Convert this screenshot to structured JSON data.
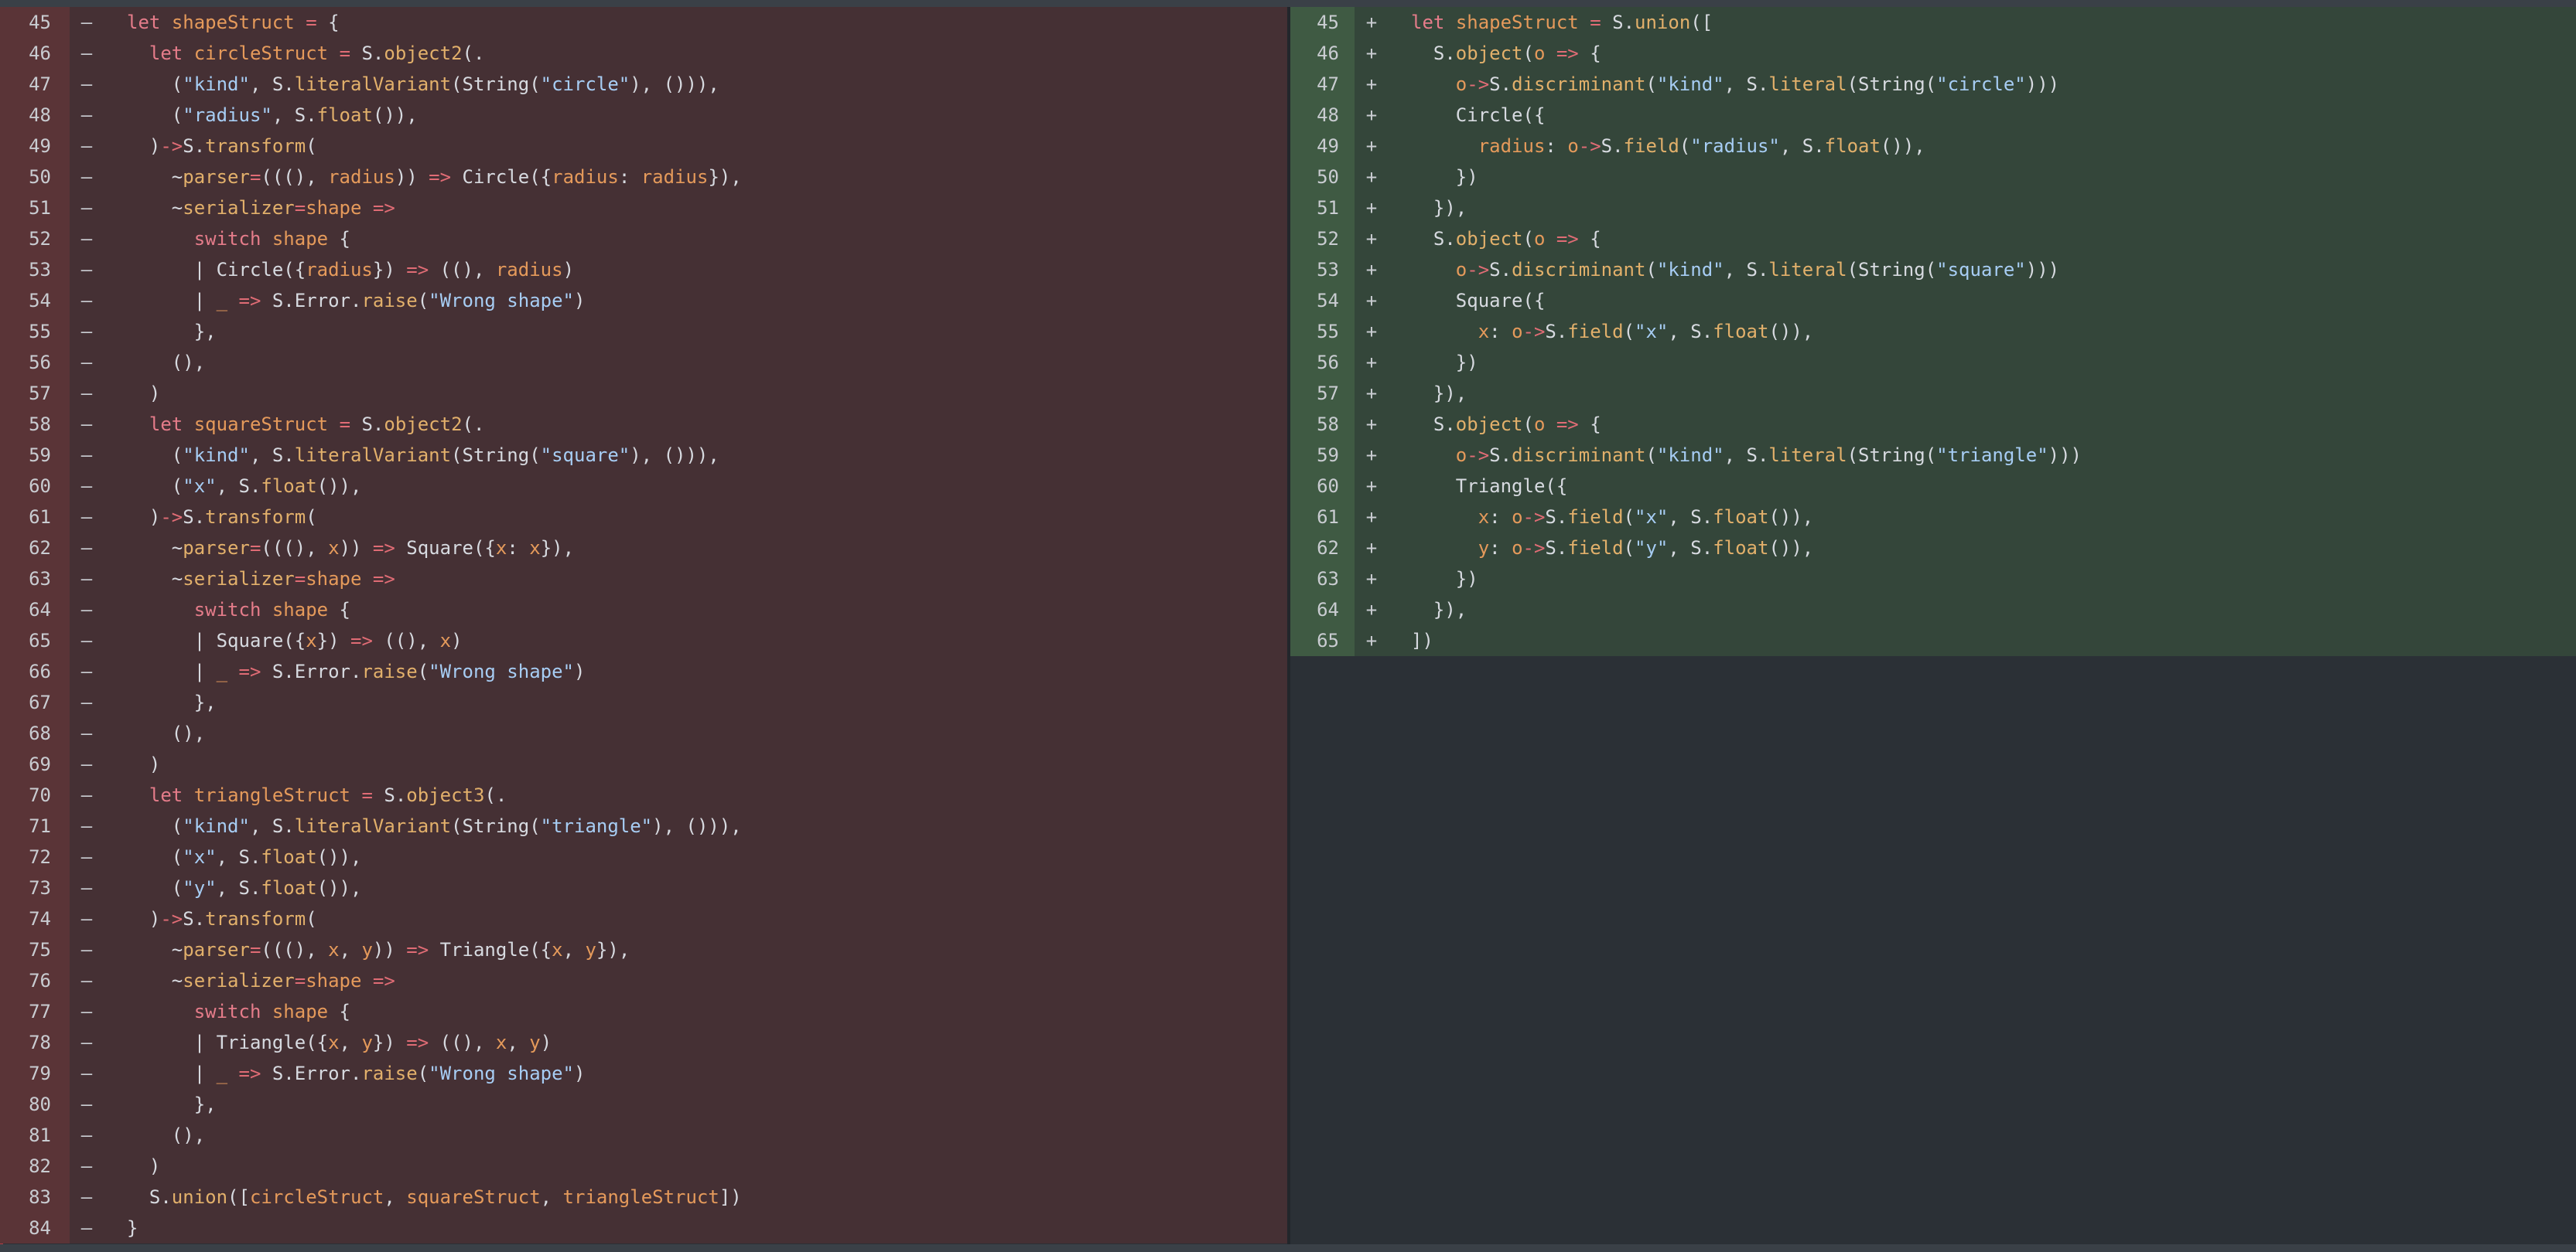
{
  "left": {
    "sign": "–",
    "lines": [
      {
        "n": "45",
        "html": "<span class=\"kw\">let</span> <span class=\"or\">shapeStruct</span> <span class=\"op\">=</span> {"
      },
      {
        "n": "46",
        "html": "  <span class=\"kw\">let</span> <span class=\"or\">circleStruct</span> <span class=\"op\">=</span> S.<span class=\"fn\">object2</span>(."
      },
      {
        "n": "47",
        "html": "    (<span class=\"st\">\"kind\"</span>, S.<span class=\"fn\">literalVariant</span>(String(<span class=\"st\">\"circle\"</span>), ())),"
      },
      {
        "n": "48",
        "html": "    (<span class=\"st\">\"radius\"</span>, S.<span class=\"fn\">float</span>()),"
      },
      {
        "n": "49",
        "html": "  )<span class=\"op\">-&gt;</span>S.<span class=\"fn\">transform</span>("
      },
      {
        "n": "50",
        "html": "    ~<span class=\"fn\">parser</span><span class=\"op\">=</span>(((), <span class=\"or\">radius</span>)) <span class=\"op\">=&gt;</span> Circle({<span class=\"or\">radius</span>: <span class=\"or\">radius</span>}),"
      },
      {
        "n": "51",
        "html": "    ~<span class=\"fn\">serializer</span><span class=\"op\">=</span><span class=\"or\">shape</span> <span class=\"op\">=&gt;</span>"
      },
      {
        "n": "52",
        "html": "      <span class=\"kw\">switch</span> <span class=\"or\">shape</span> {"
      },
      {
        "n": "53",
        "html": "      | Circle({<span class=\"or\">radius</span>}) <span class=\"op\">=&gt;</span> ((), <span class=\"or\">radius</span>)"
      },
      {
        "n": "54",
        "html": "      | <span class=\"or\">_</span> <span class=\"op\">=&gt;</span> S.Error.<span class=\"fn\">raise</span>(<span class=\"st\">\"Wrong shape\"</span>)"
      },
      {
        "n": "55",
        "html": "      },"
      },
      {
        "n": "56",
        "html": "    (),"
      },
      {
        "n": "57",
        "html": "  )"
      },
      {
        "n": "58",
        "html": "  <span class=\"kw\">let</span> <span class=\"or\">squareStruct</span> <span class=\"op\">=</span> S.<span class=\"fn\">object2</span>(."
      },
      {
        "n": "59",
        "html": "    (<span class=\"st\">\"kind\"</span>, S.<span class=\"fn\">literalVariant</span>(String(<span class=\"st\">\"square\"</span>), ())),"
      },
      {
        "n": "60",
        "html": "    (<span class=\"st\">\"x\"</span>, S.<span class=\"fn\">float</span>()),"
      },
      {
        "n": "61",
        "html": "  )<span class=\"op\">-&gt;</span>S.<span class=\"fn\">transform</span>("
      },
      {
        "n": "62",
        "html": "    ~<span class=\"fn\">parser</span><span class=\"op\">=</span>(((), <span class=\"or\">x</span>)) <span class=\"op\">=&gt;</span> Square({<span class=\"or\">x</span>: <span class=\"or\">x</span>}),"
      },
      {
        "n": "63",
        "html": "    ~<span class=\"fn\">serializer</span><span class=\"op\">=</span><span class=\"or\">shape</span> <span class=\"op\">=&gt;</span>"
      },
      {
        "n": "64",
        "html": "      <span class=\"kw\">switch</span> <span class=\"or\">shape</span> {"
      },
      {
        "n": "65",
        "html": "      | Square({<span class=\"or\">x</span>}) <span class=\"op\">=&gt;</span> ((), <span class=\"or\">x</span>)"
      },
      {
        "n": "66",
        "html": "      | <span class=\"or\">_</span> <span class=\"op\">=&gt;</span> S.Error.<span class=\"fn\">raise</span>(<span class=\"st\">\"Wrong shape\"</span>)"
      },
      {
        "n": "67",
        "html": "      },"
      },
      {
        "n": "68",
        "html": "    (),"
      },
      {
        "n": "69",
        "html": "  )"
      },
      {
        "n": "70",
        "html": "  <span class=\"kw\">let</span> <span class=\"or\">triangleStruct</span> <span class=\"op\">=</span> S.<span class=\"fn\">object3</span>(."
      },
      {
        "n": "71",
        "html": "    (<span class=\"st\">\"kind\"</span>, S.<span class=\"fn\">literalVariant</span>(String(<span class=\"st\">\"triangle\"</span>), ())),"
      },
      {
        "n": "72",
        "html": "    (<span class=\"st\">\"x\"</span>, S.<span class=\"fn\">float</span>()),"
      },
      {
        "n": "73",
        "html": "    (<span class=\"st\">\"y\"</span>, S.<span class=\"fn\">float</span>()),"
      },
      {
        "n": "74",
        "html": "  )<span class=\"op\">-&gt;</span>S.<span class=\"fn\">transform</span>("
      },
      {
        "n": "75",
        "html": "    ~<span class=\"fn\">parser</span><span class=\"op\">=</span>(((), <span class=\"or\">x</span>, <span class=\"or\">y</span>)) <span class=\"op\">=&gt;</span> Triangle({<span class=\"or\">x</span>, <span class=\"or\">y</span>}),"
      },
      {
        "n": "76",
        "html": "    ~<span class=\"fn\">serializer</span><span class=\"op\">=</span><span class=\"or\">shape</span> <span class=\"op\">=&gt;</span>"
      },
      {
        "n": "77",
        "html": "      <span class=\"kw\">switch</span> <span class=\"or\">shape</span> {"
      },
      {
        "n": "78",
        "html": "      | Triangle({<span class=\"or\">x</span>, <span class=\"or\">y</span>}) <span class=\"op\">=&gt;</span> ((), <span class=\"or\">x</span>, <span class=\"or\">y</span>)"
      },
      {
        "n": "79",
        "html": "      | <span class=\"or\">_</span> <span class=\"op\">=&gt;</span> S.Error.<span class=\"fn\">raise</span>(<span class=\"st\">\"Wrong shape\"</span>)"
      },
      {
        "n": "80",
        "html": "      },"
      },
      {
        "n": "81",
        "html": "    (),"
      },
      {
        "n": "82",
        "html": "  )"
      },
      {
        "n": "83",
        "html": "  S.<span class=\"fn\">union</span>([<span class=\"or\">circleStruct</span>, <span class=\"or\">squareStruct</span>, <span class=\"or\">triangleStruct</span>])"
      },
      {
        "n": "84",
        "html": "}"
      }
    ]
  },
  "right": {
    "sign": "+",
    "lines": [
      {
        "n": "45",
        "html": "<span class=\"kw\">let</span> <span class=\"or\">shapeStruct</span> <span class=\"op\">=</span> S.<span class=\"fn\">union</span>(["
      },
      {
        "n": "46",
        "html": "  S.<span class=\"fn\">object</span>(<span class=\"or\">o</span> <span class=\"op\">=&gt;</span> {"
      },
      {
        "n": "47",
        "html": "    <span class=\"or\">o</span><span class=\"op\">-&gt;</span>S.<span class=\"fn\">discriminant</span>(<span class=\"st\">\"kind\"</span>, S.<span class=\"fn\">literal</span>(String(<span class=\"st\">\"circle\"</span>)))"
      },
      {
        "n": "48",
        "html": "    Circle({"
      },
      {
        "n": "49",
        "html": "      <span class=\"or\">radius</span>: <span class=\"or\">o</span><span class=\"op\">-&gt;</span>S.<span class=\"fn\">field</span>(<span class=\"st\">\"radius\"</span>, S.<span class=\"fn\">float</span>()),"
      },
      {
        "n": "50",
        "html": "    })"
      },
      {
        "n": "51",
        "html": "  }),"
      },
      {
        "n": "52",
        "html": "  S.<span class=\"fn\">object</span>(<span class=\"or\">o</span> <span class=\"op\">=&gt;</span> {"
      },
      {
        "n": "53",
        "html": "    <span class=\"or\">o</span><span class=\"op\">-&gt;</span>S.<span class=\"fn\">discriminant</span>(<span class=\"st\">\"kind\"</span>, S.<span class=\"fn\">literal</span>(String(<span class=\"st\">\"square\"</span>)))"
      },
      {
        "n": "54",
        "html": "    Square({"
      },
      {
        "n": "55",
        "html": "      <span class=\"or\">x</span>: <span class=\"or\">o</span><span class=\"op\">-&gt;</span>S.<span class=\"fn\">field</span>(<span class=\"st\">\"x\"</span>, S.<span class=\"fn\">float</span>()),"
      },
      {
        "n": "56",
        "html": "    })"
      },
      {
        "n": "57",
        "html": "  }),"
      },
      {
        "n": "58",
        "html": "  S.<span class=\"fn\">object</span>(<span class=\"or\">o</span> <span class=\"op\">=&gt;</span> {"
      },
      {
        "n": "59",
        "html": "    <span class=\"or\">o</span><span class=\"op\">-&gt;</span>S.<span class=\"fn\">discriminant</span>(<span class=\"st\">\"kind\"</span>, S.<span class=\"fn\">literal</span>(String(<span class=\"st\">\"triangle\"</span>)))"
      },
      {
        "n": "60",
        "html": "    Triangle({"
      },
      {
        "n": "61",
        "html": "      <span class=\"or\">x</span>: <span class=\"or\">o</span><span class=\"op\">-&gt;</span>S.<span class=\"fn\">field</span>(<span class=\"st\">\"x\"</span>, S.<span class=\"fn\">float</span>()),"
      },
      {
        "n": "62",
        "html": "      <span class=\"or\">y</span>: <span class=\"or\">o</span><span class=\"op\">-&gt;</span>S.<span class=\"fn\">field</span>(<span class=\"st\">\"y\"</span>, S.<span class=\"fn\">float</span>()),"
      },
      {
        "n": "63",
        "html": "    })"
      },
      {
        "n": "64",
        "html": "  }),"
      },
      {
        "n": "65",
        "html": "])"
      }
    ]
  }
}
